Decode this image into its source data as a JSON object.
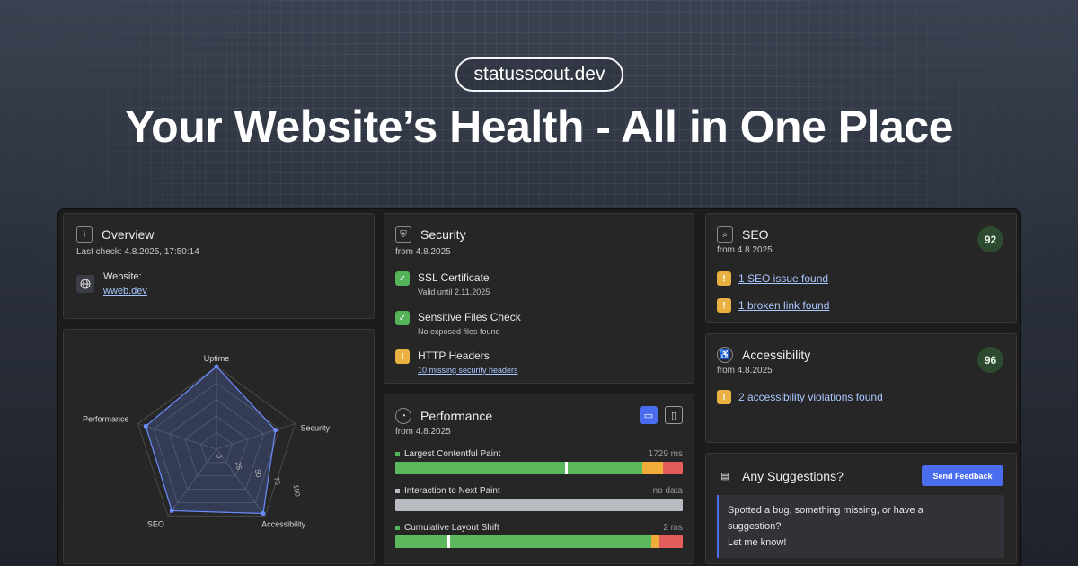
{
  "brand": {
    "pill": "statusscout.dev",
    "headline": "Your Website’s Health - All in One Place"
  },
  "overview": {
    "title": "Overview",
    "last_check": "Last check: 4.8.2025, 17:50:14",
    "website_label": "Website:",
    "website_value": "wweb.dev"
  },
  "radar": {
    "axes": [
      "Uptime",
      "Security",
      "Accessibility",
      "SEO",
      "Performance"
    ],
    "values": [
      100,
      75,
      96,
      92,
      90
    ],
    "ticks": [
      "0",
      "25",
      "50",
      "75",
      "100"
    ],
    "color": "#6b8cff"
  },
  "security": {
    "title": "Security",
    "from": "from 4.8.2025",
    "items": [
      {
        "title": "SSL Certificate",
        "sub": "Valid until 2.11.2025",
        "status": "ok"
      },
      {
        "title": "Sensitive Files Check",
        "sub": "No exposed files found",
        "status": "ok"
      },
      {
        "title": "HTTP Headers",
        "sub": "10 missing security headers",
        "status": "warn"
      }
    ]
  },
  "performance": {
    "title": "Performance",
    "from": "from 4.8.2025",
    "metrics": [
      {
        "label": "Largest Contentful Paint",
        "value": "1729 ms",
        "good": 0.86,
        "mid": 0.07,
        "poor": 0.07,
        "marker": 0.59
      },
      {
        "label": "Interaction to Next Paint",
        "value": "no data"
      },
      {
        "label": "Cumulative Layout Shift",
        "value": "2 ms",
        "good": 0.89,
        "mid": 0.03,
        "poor": 0.08,
        "marker": 0.18
      }
    ]
  },
  "seo": {
    "title": "SEO",
    "from": "from 4.8.2025",
    "score": "92",
    "issues": [
      "1 SEO issue found",
      "1 broken link found"
    ]
  },
  "accessibility": {
    "title": "Accessibility",
    "from": "from 4.8.2025",
    "score": "96",
    "issues": [
      "2 accessibility violations found"
    ]
  },
  "suggestions": {
    "title": "Any Suggestions?",
    "button": "Send Feedback",
    "line1": "Spotted a bug, something missing, or have a",
    "line2": "suggestion?",
    "line3": "Let me know!"
  },
  "colors": {
    "good": "#5cb85c",
    "mid": "#f0ad3a",
    "poor": "#e35d5d",
    "nodata": "#b8bcc2",
    "accent": "#4a6df0"
  }
}
